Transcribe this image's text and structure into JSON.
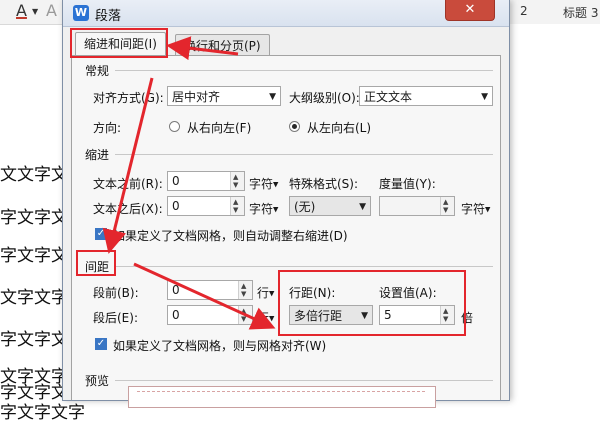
{
  "document": {
    "toolbar": {
      "font_color_glyph": "A",
      "clear_format_glyph": "A",
      "style_2_label": "2",
      "style_3_label": "标题 3"
    },
    "lines": [
      "文文字文字",
      "字文字文",
      "字文字文字",
      "文字文字文",
      "字文字文",
      "文字文字文",
      "字文字文",
      "字文字文字"
    ]
  },
  "dialog": {
    "title": "段落",
    "app_icon_glyph": "W",
    "close_glyph": "✕",
    "tabs": [
      {
        "label": "缩进和间距(I)",
        "active": true
      },
      {
        "label": "换行和分页(P)",
        "active": false
      }
    ],
    "general": {
      "section_title": "常规",
      "alignment_label": "对齐方式(G):",
      "alignment_value": "居中对齐",
      "outline_label": "大纲级别(O):",
      "outline_value": "正文文本",
      "direction_label": "方向:",
      "rtl_label": "从右向左(F)",
      "ltr_label": "从左向右(L)",
      "direction_selected": "从左向右(L)"
    },
    "indent": {
      "section_title": "缩进",
      "before_text_label": "文本之前(R):",
      "before_text_value": "0",
      "after_text_label": "文本之后(X):",
      "after_text_value": "0",
      "unit": "字符",
      "special_label": "特殊格式(S):",
      "special_value": "(无)",
      "measure_label": "度量值(Y):",
      "measure_value": "",
      "measure_unit": "字符",
      "auto_adjust_label": "如果定义了文档网格，则自动调整右缩进(D)",
      "auto_adjust_checked": true
    },
    "spacing": {
      "section_title": "间距",
      "before_label": "段前(B):",
      "before_value": "0",
      "after_label": "段后(E):",
      "after_value": "0",
      "unit": "行",
      "line_spacing_label": "行距(N):",
      "line_spacing_value": "多倍行距",
      "set_value_label": "设置值(A):",
      "set_value": "5",
      "set_value_unit": "倍",
      "snap_grid_label": "如果定义了文档网格，则与网格对齐(W)",
      "snap_grid_checked": true
    },
    "preview": {
      "section_title": "预览"
    }
  },
  "colors": {
    "annotation_red": "#e3262d",
    "close_button": "#c94b3c",
    "checkbox_blue": "#3a76c4"
  }
}
